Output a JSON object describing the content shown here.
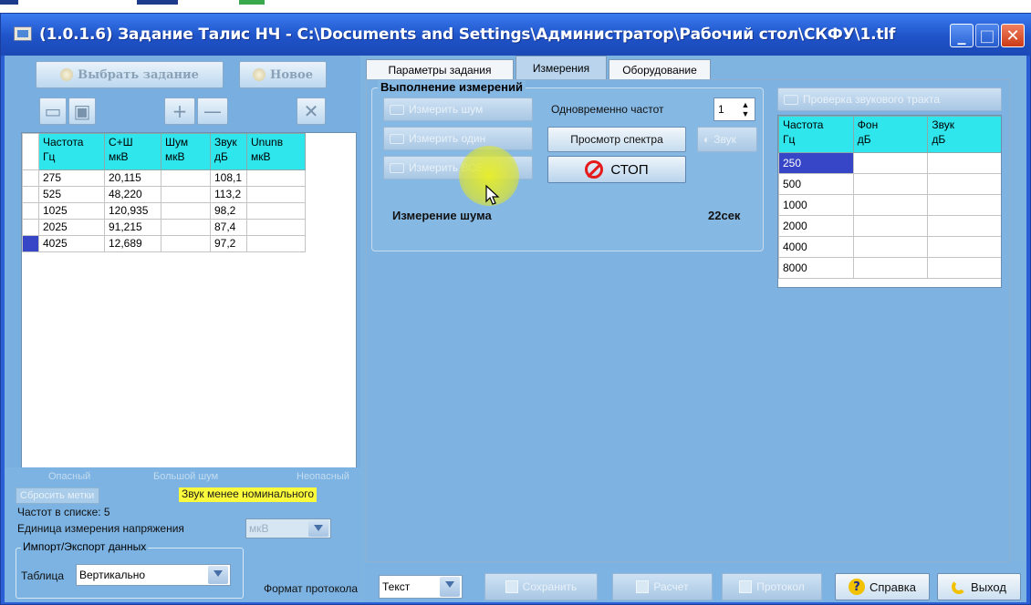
{
  "window": {
    "title": "(1.0.1.6) Задание Талис НЧ - C:\\Documents and Settings\\Администратор\\Рабочий стол\\СКФУ\\1.tlf",
    "icons": {
      "minimize": "minimize-icon",
      "maximize": "maximize-icon",
      "close": "close-icon"
    }
  },
  "left": {
    "select_task_label": "Выбрать задание",
    "new_label": "Новое",
    "table": {
      "columns": [
        {
          "line1": "Частота",
          "line2": "Гц"
        },
        {
          "line1": "С+Ш",
          "line2": "мкВ"
        },
        {
          "line1": "Шум",
          "line2": "мкВ"
        },
        {
          "line1": "Звук",
          "line2": "дБ"
        },
        {
          "line1": "Ununв",
          "line2": "мкВ"
        }
      ],
      "rows": [
        [
          "275",
          "20,115",
          "",
          "108,1",
          ""
        ],
        [
          "525",
          "48,220",
          "",
          "113,2",
          ""
        ],
        [
          "1025",
          "120,935",
          "",
          "98,2",
          ""
        ],
        [
          "2025",
          "91,215",
          "",
          "87,4",
          ""
        ],
        [
          "4025",
          "12,689",
          "",
          "97,2",
          ""
        ]
      ]
    },
    "legend": {
      "dangerous": "Опасный",
      "big_noise": "Большой шум",
      "not_dangerous": "Неопасный"
    },
    "reset_marks_label": "Сбросить метки",
    "sound_below_nominal": "Звук менее номинального",
    "freq_count_label": "Частот в списке: 5",
    "voltage_unit_label": "Единица измерения напряжения",
    "voltage_unit_value": "мкВ",
    "import_export_title": "Импорт/Экспорт данных",
    "table_label": "Таблица",
    "table_value": "Вертикально"
  },
  "tabs": [
    "Параметры задания",
    "Измерения",
    "Оборудование"
  ],
  "measure": {
    "group_title": "Выполнение измерений",
    "measure_noise": "Измерить шум",
    "measure_one": "Измерить один",
    "measure_all": "Измерить ВСЕ",
    "simultaneous_label": "Одновременно частот",
    "simultaneous_value": "1",
    "view_spectrum": "Просмотр спектра",
    "sound": "Звук",
    "stop": "СТОП",
    "status_text": "Измерение шума",
    "timer": "22сек"
  },
  "path_check": {
    "button_label": "Проверка звукового тракта",
    "columns": [
      {
        "line1": "Частота",
        "line2": "Гц"
      },
      {
        "line1": "Фон",
        "line2": "дБ"
      },
      {
        "line1": "Звук",
        "line2": "дБ"
      }
    ],
    "rows": [
      [
        "250",
        "",
        ""
      ],
      [
        "500",
        "",
        ""
      ],
      [
        "1000",
        "",
        ""
      ],
      [
        "2000",
        "",
        ""
      ],
      [
        "4000",
        "",
        ""
      ],
      [
        "8000",
        "",
        ""
      ]
    ]
  },
  "bottom": {
    "format_label": "Формат протокола",
    "format_value": "Текст",
    "save": "Сохранить",
    "calc": "Расчет",
    "protocol": "Протокол",
    "help": "Справка",
    "exit": "Выход"
  },
  "colors": {
    "header_cyan": "#2ee6ec",
    "selection": "#3646c6",
    "title_blue": "#1f53c8",
    "stop_red": "#e51a1a",
    "warning_yellow": "#fbfb3c"
  }
}
